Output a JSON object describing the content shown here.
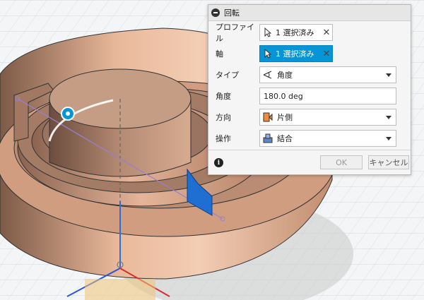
{
  "dialog": {
    "title": "回転",
    "fields": {
      "profile": {
        "label": "プロファイル",
        "value": "1 選択済み"
      },
      "axis": {
        "label": "軸",
        "value": "1 選択済み"
      },
      "type": {
        "label": "タイプ",
        "value": "角度"
      },
      "angle": {
        "label": "角度",
        "value": "180.0 deg"
      },
      "direction": {
        "label": "方向",
        "value": "片側"
      },
      "operation": {
        "label": "操作",
        "value": "結合"
      }
    },
    "buttons": {
      "ok": "OK",
      "cancel": "キャンセル"
    }
  },
  "colors": {
    "accent": "#0696d7",
    "part_body": "#c9987a",
    "grid": "#d8dbe0"
  },
  "icons": {
    "collapse": "minus-circle-icon",
    "cursor": "pointer-arrow-icon",
    "clear": "x-icon",
    "angle_type": "angle-icon",
    "direction": "one-side-icon",
    "operation": "join-icon",
    "info": "info-icon"
  }
}
